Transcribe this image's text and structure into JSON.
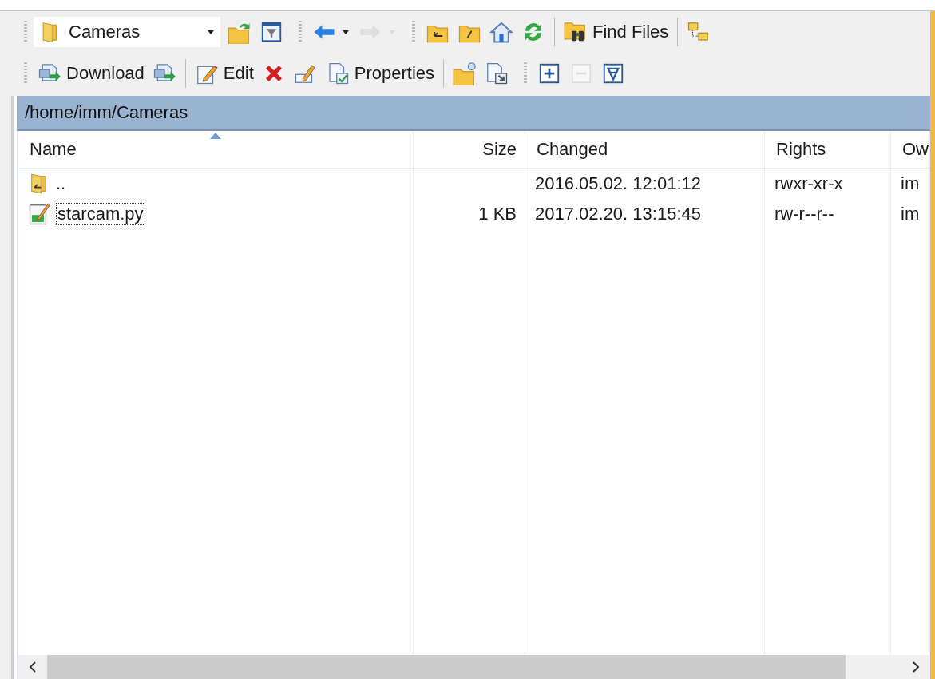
{
  "toolbars": [
    {
      "groups": [
        {
          "buttons": [
            {
              "kind": "location",
              "value": "Cameras",
              "disabled": false
            },
            {
              "kind": "openfolder",
              "disabled": false
            },
            {
              "kind": "filter",
              "disabled": false
            }
          ]
        },
        {
          "buttons": [
            {
              "kind": "back",
              "disabled": false
            },
            {
              "kind": "forward",
              "disabled": true
            }
          ]
        },
        {
          "buttons": [
            {
              "kind": "parent",
              "disabled": false
            },
            {
              "kind": "root",
              "disabled": false
            },
            {
              "kind": "home",
              "disabled": false
            },
            {
              "kind": "refresh",
              "disabled": false
            }
          ]
        },
        {
          "buttons": [
            {
              "kind": "find",
              "label": "Find Files",
              "disabled": false
            }
          ]
        },
        {
          "buttons": [
            {
              "kind": "tree",
              "disabled": false
            }
          ]
        }
      ]
    },
    {
      "groups": [
        {
          "buttons": [
            {
              "kind": "download",
              "label": "Download",
              "disabled": false
            },
            {
              "kind": "downloadalt",
              "disabled": false
            }
          ]
        },
        {
          "buttons": [
            {
              "kind": "edit",
              "label": "Edit",
              "disabled": false
            },
            {
              "kind": "delete",
              "disabled": false
            },
            {
              "kind": "rename",
              "disabled": false
            },
            {
              "kind": "properties",
              "label": "Properties",
              "disabled": false
            }
          ]
        },
        {
          "buttons": [
            {
              "kind": "newfolder",
              "disabled": false
            },
            {
              "kind": "shortcut",
              "disabled": false
            }
          ]
        },
        {
          "buttons": [
            {
              "kind": "plus",
              "disabled": false
            },
            {
              "kind": "minus",
              "disabled": true
            },
            {
              "kind": "selectfilter",
              "disabled": false
            }
          ]
        }
      ]
    }
  ],
  "path_bar": {
    "path": "/home/imm/Cameras"
  },
  "table": {
    "columns": [
      {
        "label": "Name",
        "sorted": true
      },
      {
        "label": "Size",
        "sorted": false
      },
      {
        "label": "Changed",
        "sorted": false
      },
      {
        "label": "Rights",
        "sorted": false
      },
      {
        "label": "Ow",
        "sorted": false
      }
    ],
    "rows": [
      {
        "kind": "parent",
        "cells": [
          "..",
          "",
          "2016.05.02. 12:01:12",
          "rwxr-xr-x",
          "im"
        ],
        "focused": false
      },
      {
        "kind": "file",
        "cells": [
          "starcam.py",
          "1 KB",
          "2017.02.20. 13:15:45",
          "rw-r--r--",
          "im"
        ],
        "focused": true
      }
    ]
  }
}
